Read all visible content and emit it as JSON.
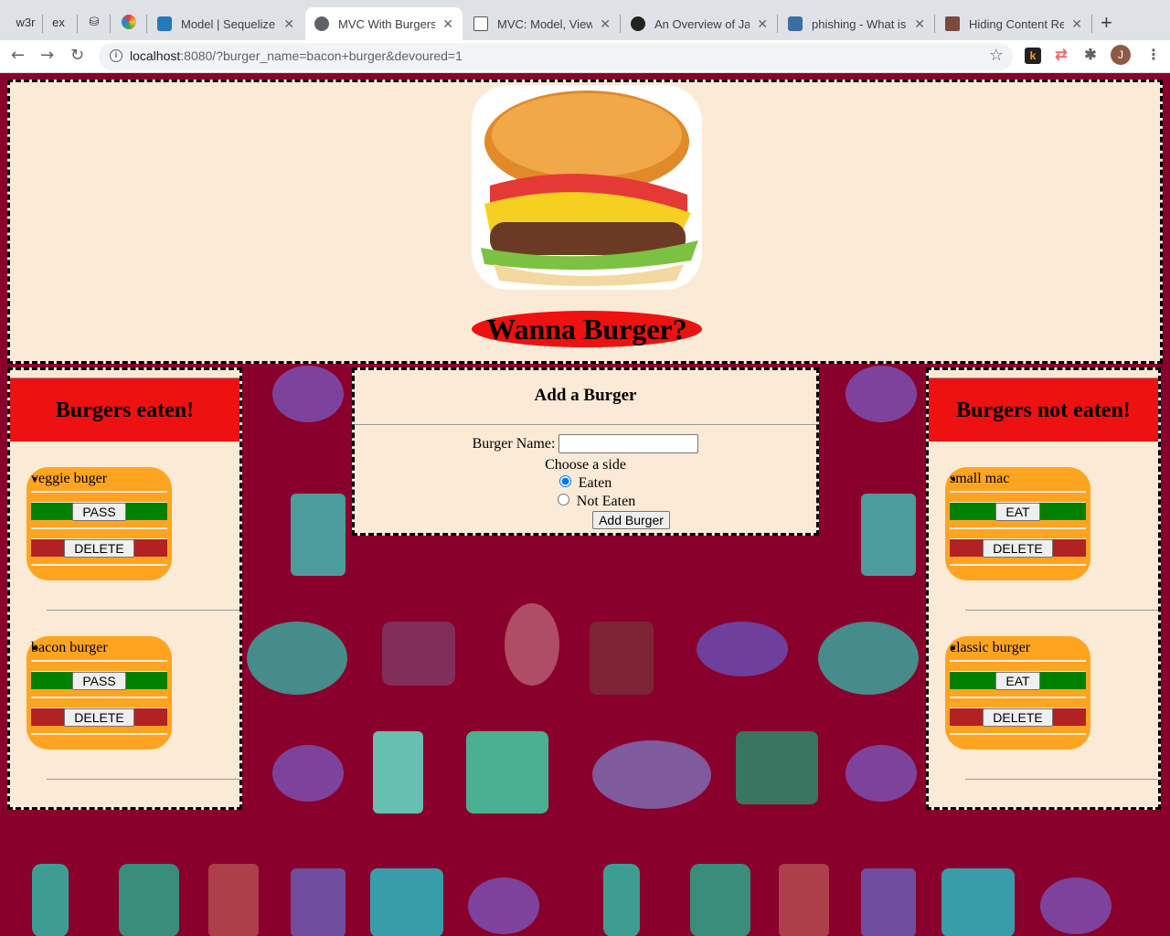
{
  "browser": {
    "tabs": [
      {
        "label": "w3r",
        "pinned": true
      },
      {
        "label": "ex",
        "pinned": true
      },
      {
        "label": "db-icon",
        "pinned": true
      },
      {
        "label": "colorful-icon",
        "pinned": true
      },
      {
        "label": "Model | Sequelize",
        "active": false
      },
      {
        "label": "MVC With Burgers!",
        "active": true
      },
      {
        "label": "MVC: Model, View,",
        "active": false
      },
      {
        "label": "An Overview of Jav",
        "active": false
      },
      {
        "label": "phishing - What is",
        "active": false
      },
      {
        "label": "Hiding Content Res",
        "active": false
      }
    ],
    "url_host": "localhost",
    "url_rest": ":8080/?burger_name=bacon+burger&devoured=1",
    "avatar_letter": "J",
    "ext_letter": "k"
  },
  "page": {
    "title": "Wanna Burger?",
    "eaten": {
      "heading": "Burgers eaten!",
      "items": [
        {
          "name": "veggie buger",
          "action": "PASS",
          "delete": "DELETE"
        },
        {
          "name": "bacon burger",
          "action": "PASS",
          "delete": "DELETE"
        }
      ]
    },
    "not_eaten": {
      "heading": "Burgers not eaten!",
      "items": [
        {
          "name": "small mac",
          "action": "EAT",
          "delete": "DELETE"
        },
        {
          "name": "classic burger",
          "action": "EAT",
          "delete": "DELETE"
        }
      ]
    },
    "form": {
      "heading": "Add a Burger",
      "name_label": "Burger Name:",
      "name_value": "",
      "side_label": "Choose a side",
      "radio_eaten": "Eaten",
      "radio_not_eaten": "Not Eaten",
      "selected": "Eaten",
      "submit": "Add Burger"
    }
  },
  "colors": {
    "background": "#8a002c",
    "panel": "#fbead6",
    "heading_red": "#ee1111",
    "card_orange": "#ffa420",
    "pass_green": "#008000",
    "delete_red": "#b22222"
  }
}
